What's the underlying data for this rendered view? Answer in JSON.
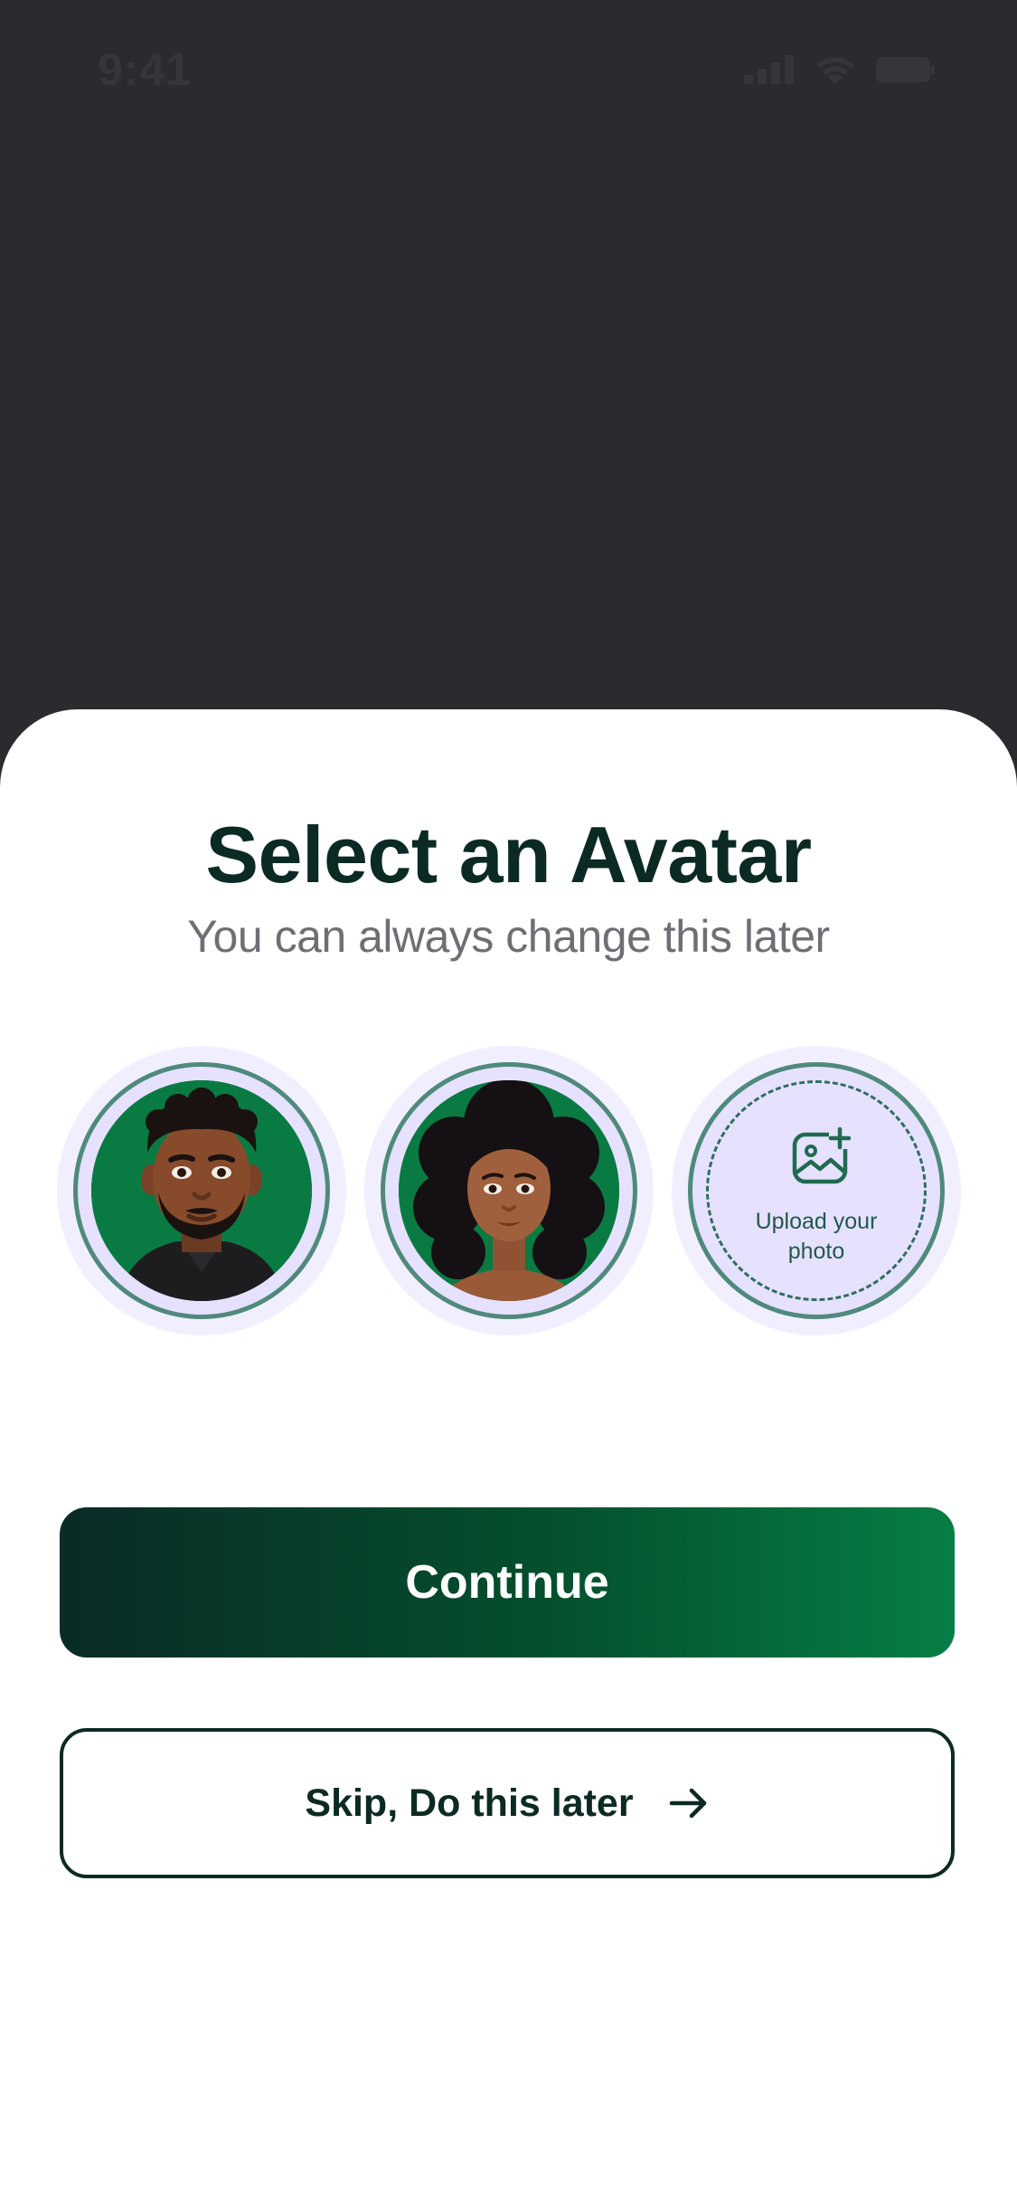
{
  "status_bar": {
    "time": "9:41",
    "icons": [
      "signal-icon",
      "wifi-icon",
      "battery-icon"
    ]
  },
  "sheet": {
    "title": "Select an Avatar",
    "subtitle": "You can always change this later"
  },
  "avatars": [
    {
      "name": "male-avatar",
      "selected": false
    },
    {
      "name": "female-avatar",
      "selected": false
    },
    {
      "name": "upload",
      "label_line1": "Upload your",
      "label_line2": "photo",
      "icon": "image-add-icon"
    }
  ],
  "buttons": {
    "continue_label": "Continue",
    "skip_label": "Skip, Do this later",
    "skip_icon": "arrow-right-icon"
  },
  "colors": {
    "overlay": "#2a2b2f",
    "brand_dark": "#0a2b27",
    "brand_green": "#067e45",
    "title_text": "#0c2a24",
    "subtitle_text": "#6e6f75",
    "avatar_halo": "#f1efff",
    "avatar_ring": "#4f8a7b"
  }
}
